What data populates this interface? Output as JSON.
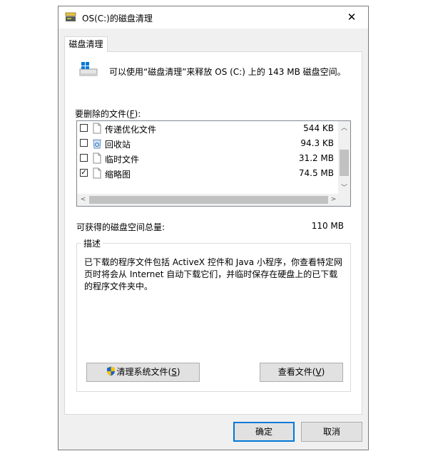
{
  "window": {
    "title": "OS(C:)的磁盘清理",
    "close": "✕"
  },
  "tab": {
    "label": "磁盘清理"
  },
  "intro": "可以使用“磁盘清理”来释放 OS (C:) 上的 143 MB 磁盘空间。",
  "files_label": {
    "text": "要删除的文件(",
    "accel": "F",
    "suffix": "):"
  },
  "files": [
    {
      "name": "传递优化文件",
      "size": "544 KB",
      "checked": false,
      "icon": "file-icon"
    },
    {
      "name": "回收站",
      "size": "94.3 KB",
      "checked": false,
      "icon": "recycle-bin-icon"
    },
    {
      "name": "临时文件",
      "size": "31.2 MB",
      "checked": false,
      "icon": "file-icon"
    },
    {
      "name": "缩略图",
      "size": "74.5 MB",
      "checked": true,
      "icon": "file-icon"
    }
  ],
  "total": {
    "label": "可获得的磁盘空间总量:",
    "value": "110 MB"
  },
  "description": {
    "title": "描述",
    "text": "已下载的程序文件包括 ActiveX 控件和 Java 小程序，你查看特定网页时将会从 Internet 自动下载它们，并临时保存在硬盘上的已下载的程序文件夹中。"
  },
  "buttons": {
    "cleanup_system": {
      "text": "清理系统文件(",
      "accel": "S",
      "suffix": ")"
    },
    "view_files": {
      "text": "查看文件(",
      "accel": "V",
      "suffix": ")"
    },
    "ok": "确定",
    "cancel": "取消"
  },
  "colors": {
    "accent": "#0078d7",
    "window_bg": "#f0f0f0",
    "button_bg": "#e1e1e1"
  }
}
